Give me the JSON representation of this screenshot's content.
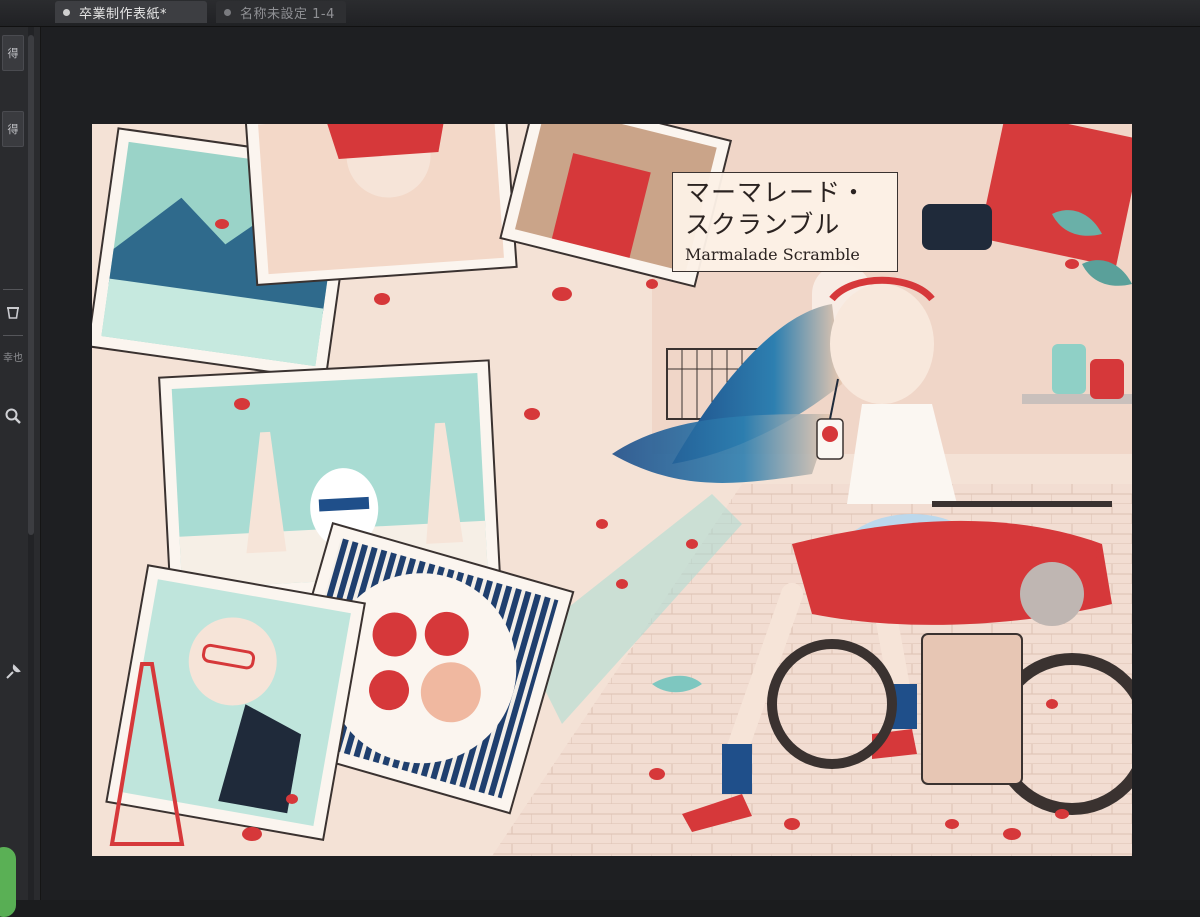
{
  "tabs": [
    {
      "label": "卒業制作表紙*",
      "active": true
    },
    {
      "label": "名称未設定 1-4",
      "active": false
    }
  ],
  "left_palette": {
    "btn1": "得",
    "btn2": "得",
    "label": "幸也"
  },
  "artwork": {
    "title_jp_line1": "マーマレード・",
    "title_jp_line2": "スクランブル",
    "title_en": "Marmalade Scramble"
  },
  "colors": {
    "accent_red": "#d9343a",
    "teal": "#8fd0c6",
    "navy": "#1f3f6e",
    "cream": "#f6e6da"
  }
}
